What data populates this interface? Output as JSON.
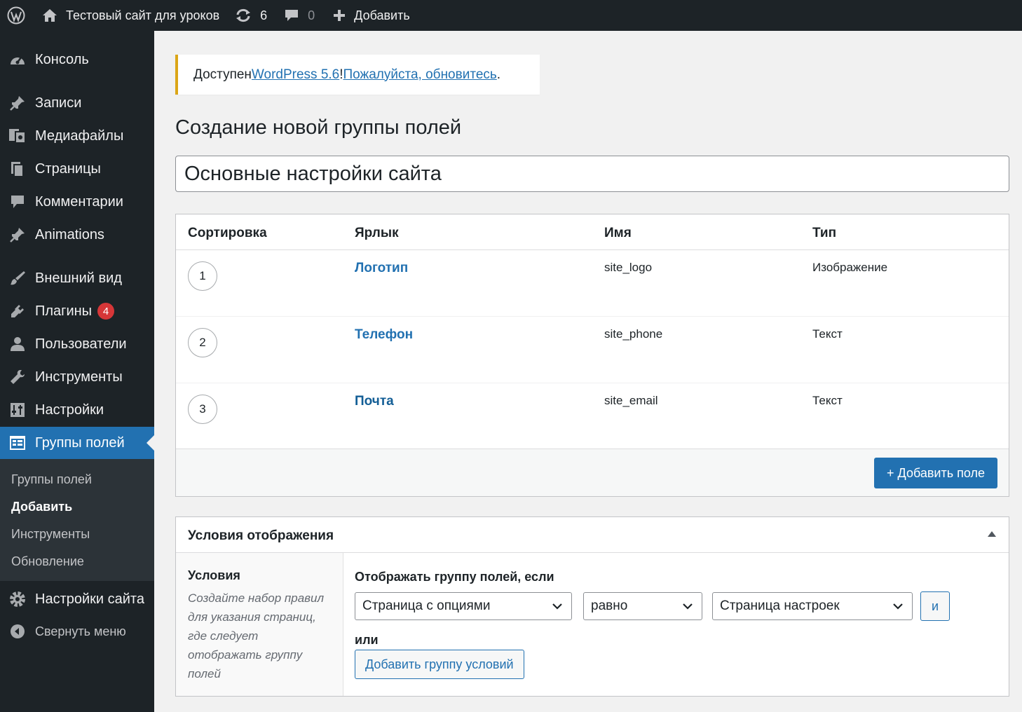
{
  "adminbar": {
    "site_name": "Тестовый сайт для уроков",
    "updates_count": "6",
    "comments_count": "0",
    "new_label": "Добавить"
  },
  "sidebar": {
    "items": [
      {
        "label": "Консоль",
        "icon": "dashboard-icon"
      },
      {
        "label": "Записи",
        "icon": "pin-icon"
      },
      {
        "label": "Медиафайлы",
        "icon": "media-icon"
      },
      {
        "label": "Страницы",
        "icon": "pages-icon"
      },
      {
        "label": "Комментарии",
        "icon": "comment-icon"
      },
      {
        "label": "Animations",
        "icon": "pin-icon"
      },
      {
        "label": "Внешний вид",
        "icon": "brush-icon"
      },
      {
        "label": "Плагины",
        "icon": "plugin-icon",
        "badge": "4"
      },
      {
        "label": "Пользователи",
        "icon": "user-icon"
      },
      {
        "label": "Инструменты",
        "icon": "wrench-icon"
      },
      {
        "label": "Настройки",
        "icon": "settings-icon"
      },
      {
        "label": "Группы полей",
        "icon": "table-icon",
        "current": true
      }
    ],
    "submenu": [
      "Группы полей",
      "Добавить",
      "Инструменты",
      "Обновление"
    ],
    "site_settings": "Настройки сайта",
    "collapse": "Свернуть меню"
  },
  "notice": {
    "prefix": "Доступен ",
    "link1": "WordPress 5.6",
    "mid": "! ",
    "link2": "Пожалуйста, обновитесь",
    "suffix": "."
  },
  "page_title": "Создание новой группы полей",
  "group_title": "Основные настройки сайта",
  "fields_table": {
    "headers": [
      "Сортировка",
      "Ярлык",
      "Имя",
      "Тип"
    ],
    "rows": [
      {
        "order": "1",
        "label": "Логотип",
        "name": "site_logo",
        "type": "Изображение"
      },
      {
        "order": "2",
        "label": "Телефон",
        "name": "site_phone",
        "type": "Текст"
      },
      {
        "order": "3",
        "label": "Почта",
        "name": "site_email",
        "type": "Текст"
      }
    ],
    "add_button": "+ Добавить поле"
  },
  "conditions": {
    "title": "Условия отображения",
    "label": "Условия",
    "description": "Создайте набор правил для указания страниц, где следует отображать группу полей",
    "show_if": "Отображать группу полей, если",
    "param": "Страница с опциями",
    "operator": "равно",
    "value": "Страница настроек",
    "and_button": "и",
    "or_label": "или",
    "add_group_button": "Добавить группу условий"
  },
  "colors": {
    "admin_dark": "#1d2327",
    "accent": "#2271b1",
    "notice_border": "#dba617",
    "badge": "#d63638"
  }
}
